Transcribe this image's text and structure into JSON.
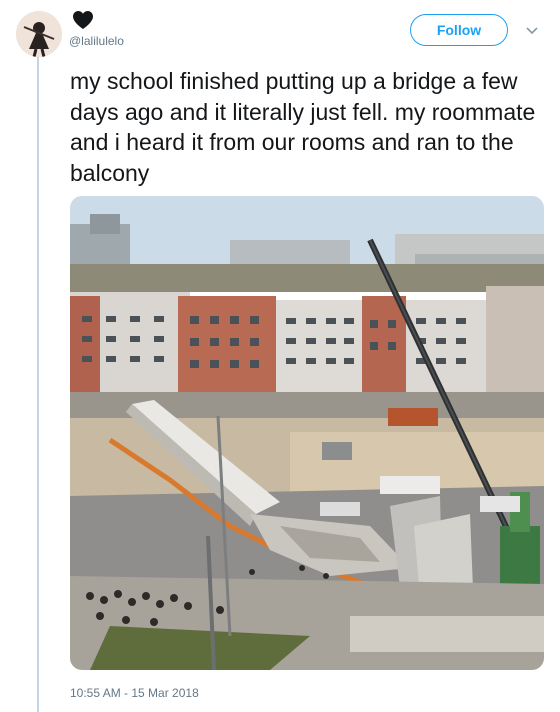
{
  "tweet": {
    "handle": "@lalilulelo",
    "text": "my school finished putting up a bridge a few days ago and it literally just fell. my roommate and i heard it from our rooms and ran to the balcony",
    "follow_label": "Follow",
    "timestamp": "10:55 AM - 15 Mar 2018"
  },
  "icons": {
    "display_name": "heart-icon",
    "menu": "chevron-down-icon"
  },
  "colors": {
    "accent": "#1da1f2",
    "text": "#14171a",
    "muted": "#657786",
    "thread_line": "#c3d6e8"
  }
}
